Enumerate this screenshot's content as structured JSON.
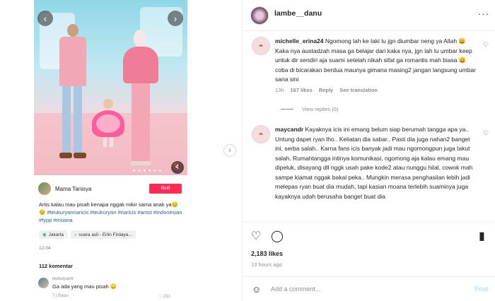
{
  "media": {
    "prev_icon": "chevron-left",
    "next_icon": "chevron-right",
    "dots": "● ● ● ● ● ●",
    "mute_icon": "speaker-muted"
  },
  "tiktok": {
    "user": "Mama Tanisya",
    "follow_label": "Ikuti",
    "caption_text": "Artis kalau mau pisah kenapa nggak mikir sama anak ya😒😒 ",
    "caption_tags": "#teukuryanriaricis #teukuryan #riaricis #artist #indonesian #fypp #moana",
    "chips": [
      "Jakarta",
      "suara asli - Erlin Firdaya..."
    ],
    "date": "12-04",
    "comment_count": "112 komentar",
    "comment": {
      "user": "teukuryantr",
      "text": "Ga ada yang mau pisah 😞",
      "meta": "7 j    Balas",
      "likes": "♡ 231"
    }
  },
  "header": {
    "username": "lambe__danu",
    "more_icon": "···"
  },
  "comments": [
    {
      "user": "michelle_erina24",
      "text": "Ngomong lah ke laki lu jgn diumbar neng ya Allah 😄 Kaka nya austadzah masa ga belajar dari kaka nya, jgn lah lu umbar keep untuk dir sendiri aja suami setelah nikah sifat ga romantis mah biasa 😄 coba di bicarakan berdua maunya gimana masing2 jangan langsung umbar sana sini",
      "time": "13h",
      "likes": "167 likes",
      "reply": "Reply",
      "translate": "See translation",
      "view_replies": "View replies (6)"
    },
    {
      "user": "maycandr",
      "text": "Kayaknya icis ini emang belum siap berumah tangga apa ya.. Untung dapet ryan lho.. Keliatan dia sabar.. Pasti dia juga nahan2 banget ini, serba salah.. Karna fans icis banyak jadi mau ngomongpun juga takut salah. Rumahtangga intinya komunikasi, ngomong aja kalau emang mau dipeluk, disayang dll nggk usah pake kode2 atau nunggu hilal, cowok mah sampe kiamat nggak bakal peka.. Mungkin merasa penghasilan lebih jadi melepas ryan buat dia mudah, tapi kasian moana terlebih suaminya juga kayaknya udah berusaha banget buat dia"
    }
  ],
  "footer": {
    "likes": "2,183 likes",
    "time": "13 hours ago",
    "add_placeholder": "Add a comment...",
    "post_label": "Post"
  }
}
